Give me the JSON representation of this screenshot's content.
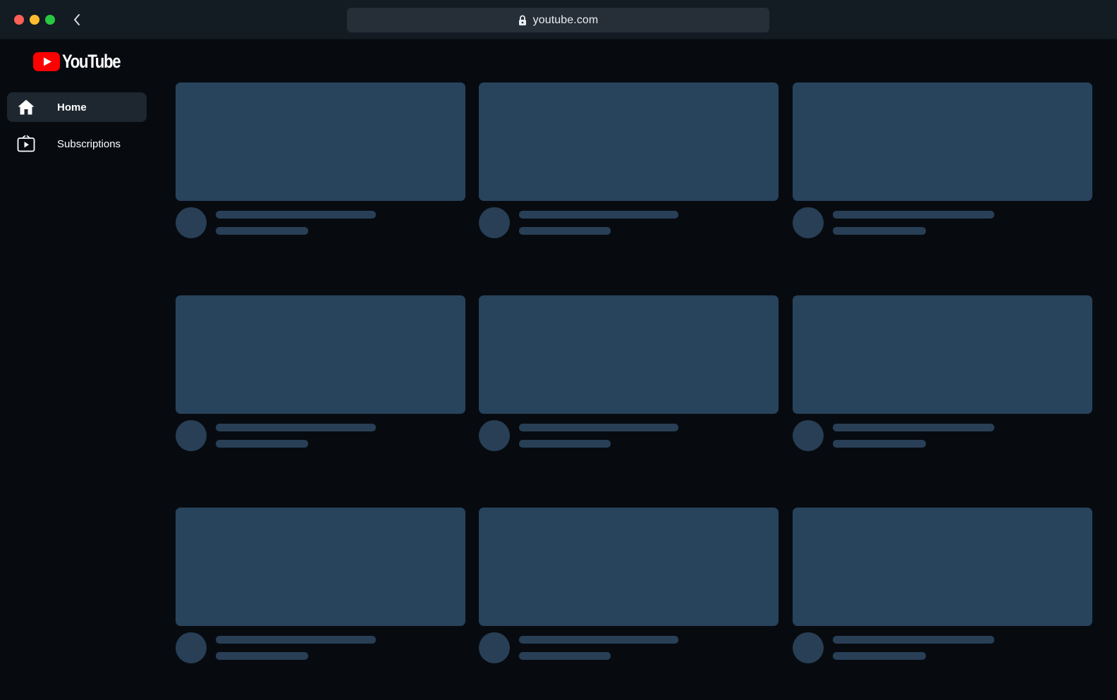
{
  "browser": {
    "url": "youtube.com"
  },
  "app": {
    "logo_text": "YouTube",
    "brand_color": "#ff0000"
  },
  "sidebar": {
    "items": [
      {
        "label": "Home",
        "icon": "home-icon",
        "active": true
      },
      {
        "label": "Subscriptions",
        "icon": "subscriptions-icon",
        "active": false
      }
    ]
  },
  "colors": {
    "background": "#070b10",
    "titlebar": "#131b23",
    "placeholder_thumbnail": "#28435c",
    "placeholder_text": "#283f56"
  }
}
